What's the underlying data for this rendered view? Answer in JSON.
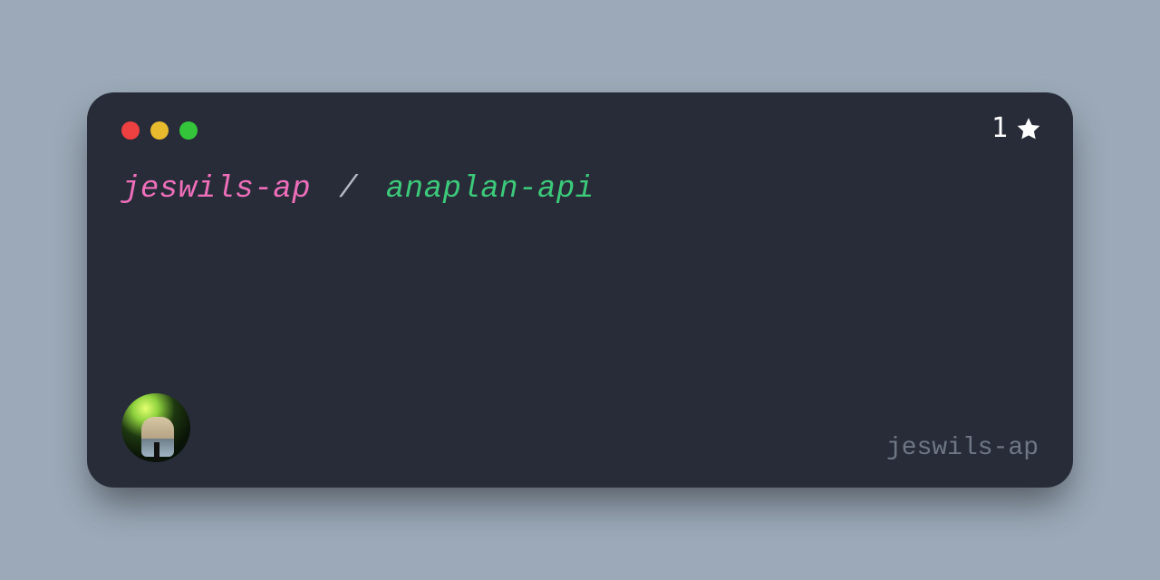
{
  "traffic_colors": {
    "red": "#ed4040",
    "yellow": "#e8bb2e",
    "green": "#35c53a"
  },
  "stars": {
    "count": "1"
  },
  "title": {
    "owner": "jeswils-ap",
    "separator": "/",
    "repo": "anaplan-api"
  },
  "footer": {
    "author": "jeswils-ap"
  }
}
